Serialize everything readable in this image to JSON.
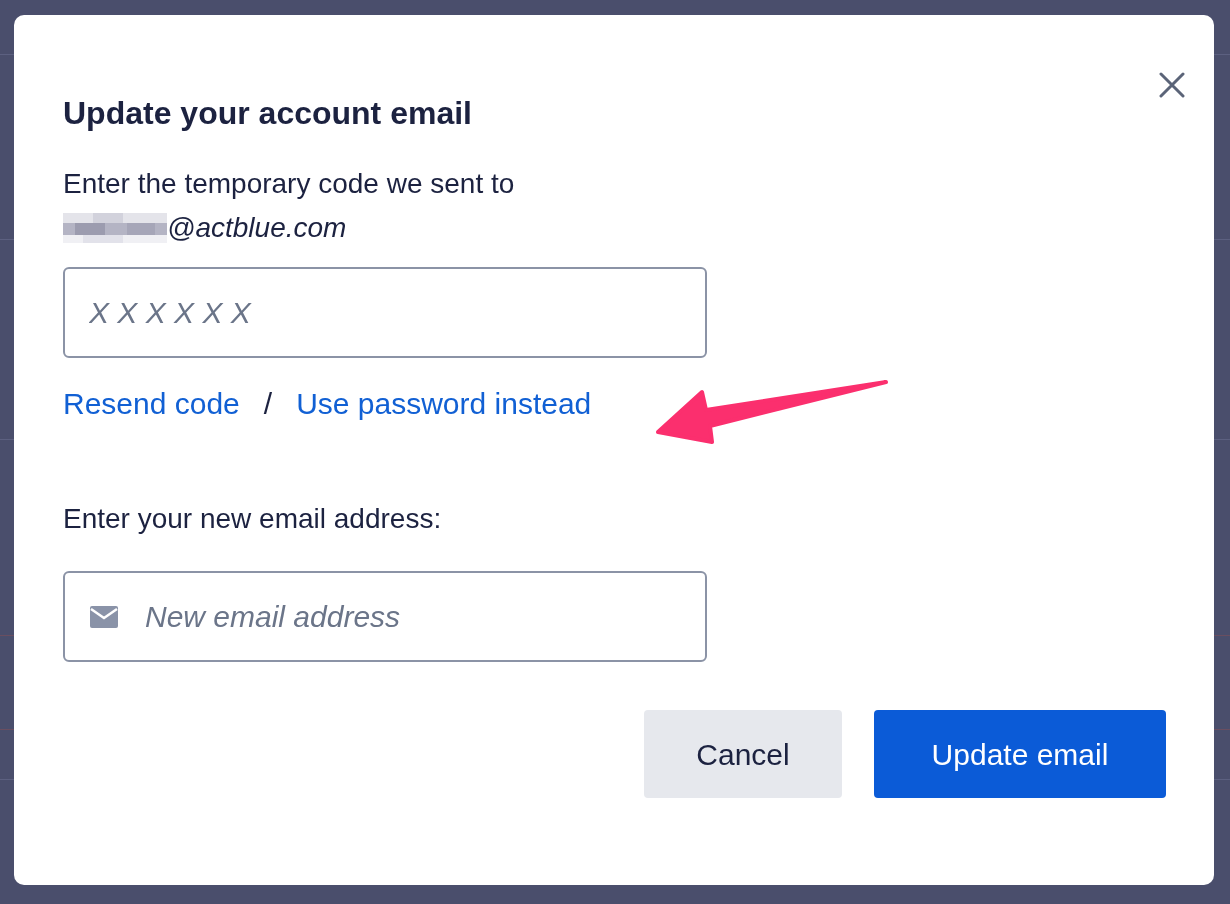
{
  "dialog": {
    "title": "Update your account email",
    "instruction": "Enter the temporary code we sent to",
    "email_domain": "@actblue.com",
    "code_field": {
      "placeholder": "X X X X X X"
    },
    "links": [
      "Resend code",
      "Use password instead"
    ],
    "link_separator": "/",
    "new_email_label": "Enter your new email address:",
    "email_field": {
      "placeholder": "New email address"
    },
    "buttons": [
      {
        "label": "Cancel",
        "kind": "secondary"
      },
      {
        "label": "Update email",
        "kind": "primary"
      }
    ]
  }
}
